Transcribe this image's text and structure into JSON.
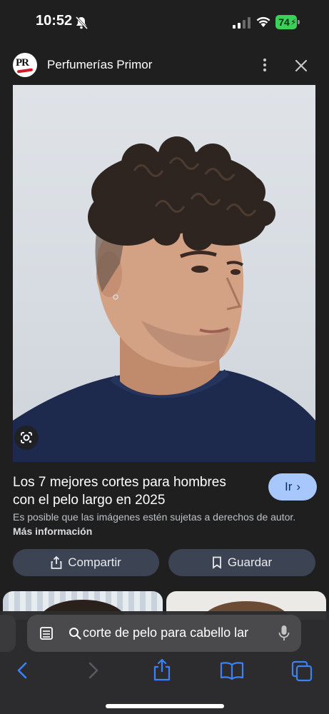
{
  "status_bar": {
    "time": "10:52",
    "battery": "74",
    "icons": [
      "mute-bell-icon",
      "signal-icon",
      "wifi-icon",
      "battery-charging-icon"
    ]
  },
  "header": {
    "site_logo_text": "PR",
    "site_name": "Perfumerías Primor",
    "icons": [
      "more-vertical-icon",
      "close-icon"
    ]
  },
  "image": {
    "lens_icon": "google-lens-icon"
  },
  "result": {
    "title": "Los 7 mejores cortes para hombres con el pelo largo en 2025",
    "go_label": "Ir",
    "copyright_text": "Es posible que las imágenes estén sujetas a derechos de autor.",
    "more_info_label": "Más información"
  },
  "actions": {
    "share_label": "Compartir",
    "save_label": "Guardar"
  },
  "browser": {
    "address_text": "corte de pelo para cabello lar",
    "icons": [
      "reader-icon",
      "search-icon",
      "mic-icon",
      "back-icon",
      "forward-icon",
      "share-icon",
      "bookmarks-icon",
      "tabs-icon"
    ]
  },
  "colors": {
    "background": "#1f1f1f",
    "go_button": "#a8c7fa",
    "pill_button": "#3c4454",
    "battery": "#3ccf5a"
  }
}
